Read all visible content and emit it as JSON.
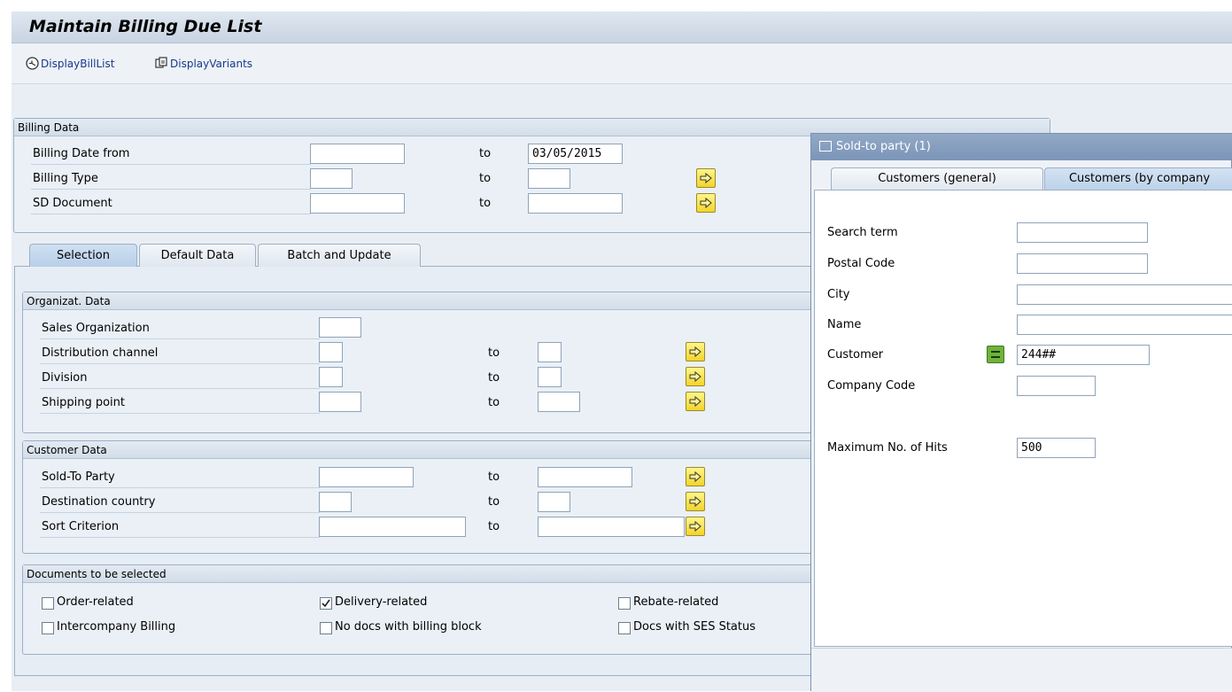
{
  "window": {
    "title": "Maintain Billing Due List"
  },
  "toolbar": {
    "display_bill_list": "DisplayBillList",
    "display_variants": "DisplayVariants"
  },
  "billing_data": {
    "header": "Billing Data",
    "to_label": "to",
    "rows": [
      {
        "label": "Billing Date from",
        "from": "",
        "to": "03/05/2015"
      },
      {
        "label": "Billing Type",
        "from": "",
        "to": ""
      },
      {
        "label": "SD Document",
        "from": "",
        "to": ""
      }
    ]
  },
  "tabs": [
    {
      "label": "Selection",
      "active": true
    },
    {
      "label": "Default Data",
      "active": false
    },
    {
      "label": "Batch and Update",
      "active": false
    }
  ],
  "org_data": {
    "header": "Organizat. Data",
    "to_label": "to",
    "rows": [
      {
        "label": "Sales Organization",
        "from": ""
      },
      {
        "label": "Distribution channel",
        "from": "",
        "to": ""
      },
      {
        "label": "Division",
        "from": "",
        "to": ""
      },
      {
        "label": "Shipping point",
        "from": "",
        "to": ""
      }
    ]
  },
  "customer_data": {
    "header": "Customer Data",
    "to_label": "to",
    "rows": [
      {
        "label": "Sold-To Party",
        "from": "",
        "to": ""
      },
      {
        "label": "Destination country",
        "from": "",
        "to": ""
      },
      {
        "label": "Sort Criterion",
        "from": "",
        "to": ""
      }
    ]
  },
  "documents": {
    "header": "Documents to be selected",
    "items": [
      {
        "label": "Order-related",
        "checked": false
      },
      {
        "label": "Delivery-related",
        "checked": true
      },
      {
        "label": "Rebate-related",
        "checked": false
      },
      {
        "label": "Intercompany Billing",
        "checked": false
      },
      {
        "label": "No docs with billing block",
        "checked": false
      },
      {
        "label": "Docs with SES Status",
        "checked": false
      }
    ]
  },
  "popup": {
    "title": "Sold-to party (1)",
    "tabs": [
      {
        "label": "Customers (general)",
        "active": false
      },
      {
        "label": "Customers (by company",
        "active": true
      }
    ],
    "fields": [
      {
        "label": "Search term",
        "value": ""
      },
      {
        "label": "Postal Code",
        "value": ""
      },
      {
        "label": "City",
        "value": ""
      },
      {
        "label": "Name",
        "value": ""
      },
      {
        "label": "Customer",
        "value": "244##"
      },
      {
        "label": "Company Code",
        "value": ""
      }
    ],
    "max_hits": {
      "label": "Maximum No. of Hits",
      "value": "500"
    }
  },
  "colors": {
    "multi_select_button": "#f3d429",
    "equals_button": "#6fb33b",
    "link_text": "#15398a"
  }
}
